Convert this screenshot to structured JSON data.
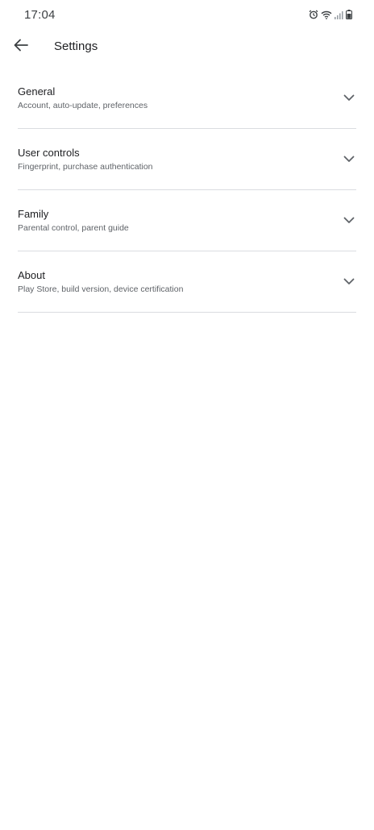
{
  "status_bar": {
    "time": "17:04",
    "icons": [
      "alarm-icon",
      "wifi-icon",
      "signal-icon",
      "battery-icon"
    ]
  },
  "app_bar": {
    "back_icon": "arrow-back-icon",
    "title": "Settings"
  },
  "settings": {
    "items": [
      {
        "title": "General",
        "subtitle": "Account, auto-update, preferences",
        "icon": "chevron-down-icon"
      },
      {
        "title": "User controls",
        "subtitle": "Fingerprint, purchase authentication",
        "icon": "chevron-down-icon"
      },
      {
        "title": "Family",
        "subtitle": "Parental control, parent guide",
        "icon": "chevron-down-icon"
      },
      {
        "title": "About",
        "subtitle": "Play Store, build version, device certification",
        "icon": "chevron-down-icon"
      }
    ]
  },
  "colors": {
    "background": "#ffffff",
    "title_text": "#202124",
    "subtitle_text": "#5f6368",
    "divider": "#dadce0",
    "icon": "#5f6368"
  }
}
